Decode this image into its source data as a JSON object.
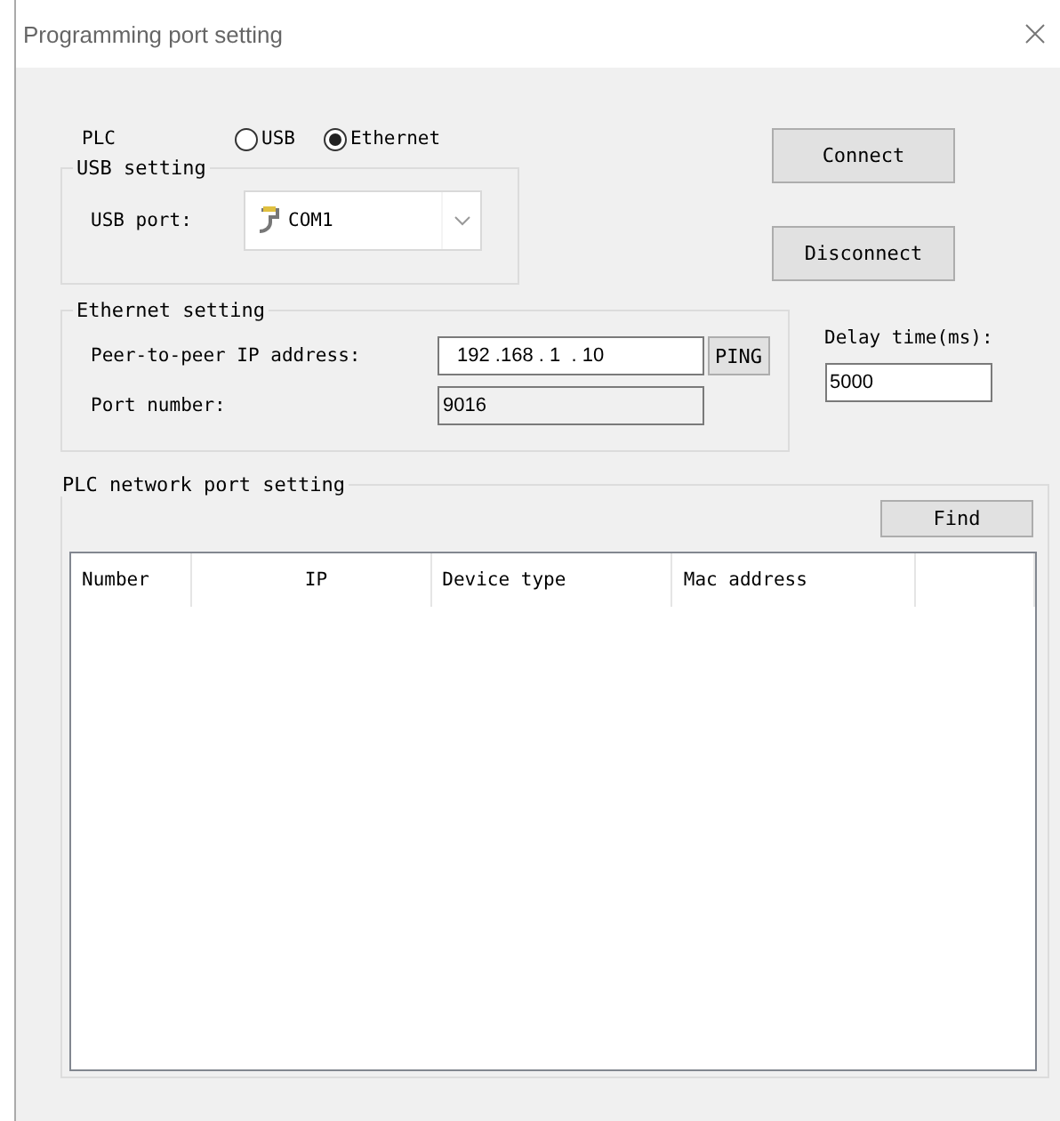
{
  "window": {
    "title": "Programming port setting"
  },
  "plc": {
    "label": "PLC",
    "options": [
      {
        "label": "USB",
        "selected": false
      },
      {
        "label": "Ethernet",
        "selected": true
      }
    ]
  },
  "usb_setting": {
    "title": "USB setting",
    "port_label": "USB port:",
    "port_value": "COM1"
  },
  "buttons": [
    "Connect",
    "Disconnect"
  ],
  "ethernet_setting": {
    "title": "Ethernet setting",
    "ip_label": "Peer-to-peer IP address:",
    "ip_value": "192 .168 . 1  . 10",
    "ping": "PING",
    "port_label": "Port number:",
    "port_value": "9016"
  },
  "delay": {
    "label": "Delay time(ms):",
    "value": "5000"
  },
  "network": {
    "title": "PLC network port setting",
    "find": "Find",
    "columns": [
      "Number",
      "IP",
      "Device type",
      "Mac address"
    ]
  }
}
